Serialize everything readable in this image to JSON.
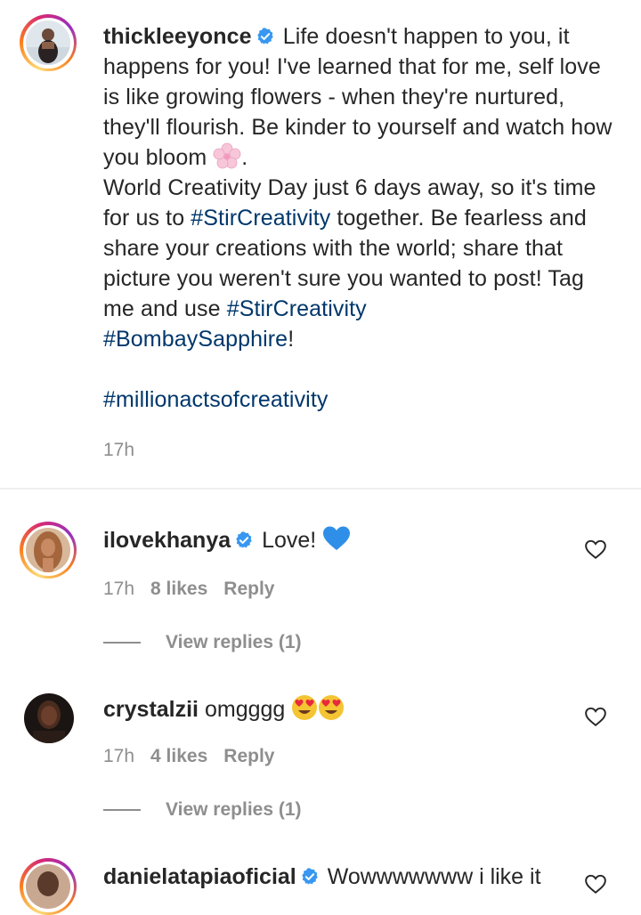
{
  "post": {
    "username": "thickleeyonce",
    "caption_part1": " Life doesn't happen to you, it happens for you! I've learned that for me, self love is like growing flowers - when they're nurtured, they'll flourish. Be kinder to yourself and watch how you bloom ",
    "caption_part2": ".",
    "caption_part3": "World Creativity Day just 6 days away, so it's time for us to ",
    "hashtag1": "#StirCreativity",
    "caption_part4": " together. Be fearless and share your creations with the world; share that picture you weren't sure you wanted to post! Tag me and use ",
    "hashtag2": "#StirCreativity",
    "hashtag3": "#BombaySapphire",
    "caption_part5": "!",
    "hashtag4": "#millionactsofcreativity",
    "time": "17h"
  },
  "comments": [
    {
      "username": "ilovekhanya",
      "text": " Love!",
      "time": "17h",
      "likes": "8 likes",
      "reply_label": "Reply",
      "view_replies": "View replies (1)"
    },
    {
      "username": "crystalzii",
      "text": " omgggg",
      "time": "17h",
      "likes": "4 likes",
      "reply_label": "Reply",
      "view_replies": "View replies (1)"
    },
    {
      "username": "danielatapiaoficial",
      "text": " Wowwwwwww i like it"
    }
  ],
  "colors": {
    "hashtag": "#00376b",
    "secondary_text": "#8e8e8e",
    "verified": "#3897f0"
  },
  "icons": [
    "verified-icon",
    "heart-outline-icon",
    "blue-heart-emoji",
    "heart-eyes-emoji",
    "cherry-blossom-emoji"
  ]
}
